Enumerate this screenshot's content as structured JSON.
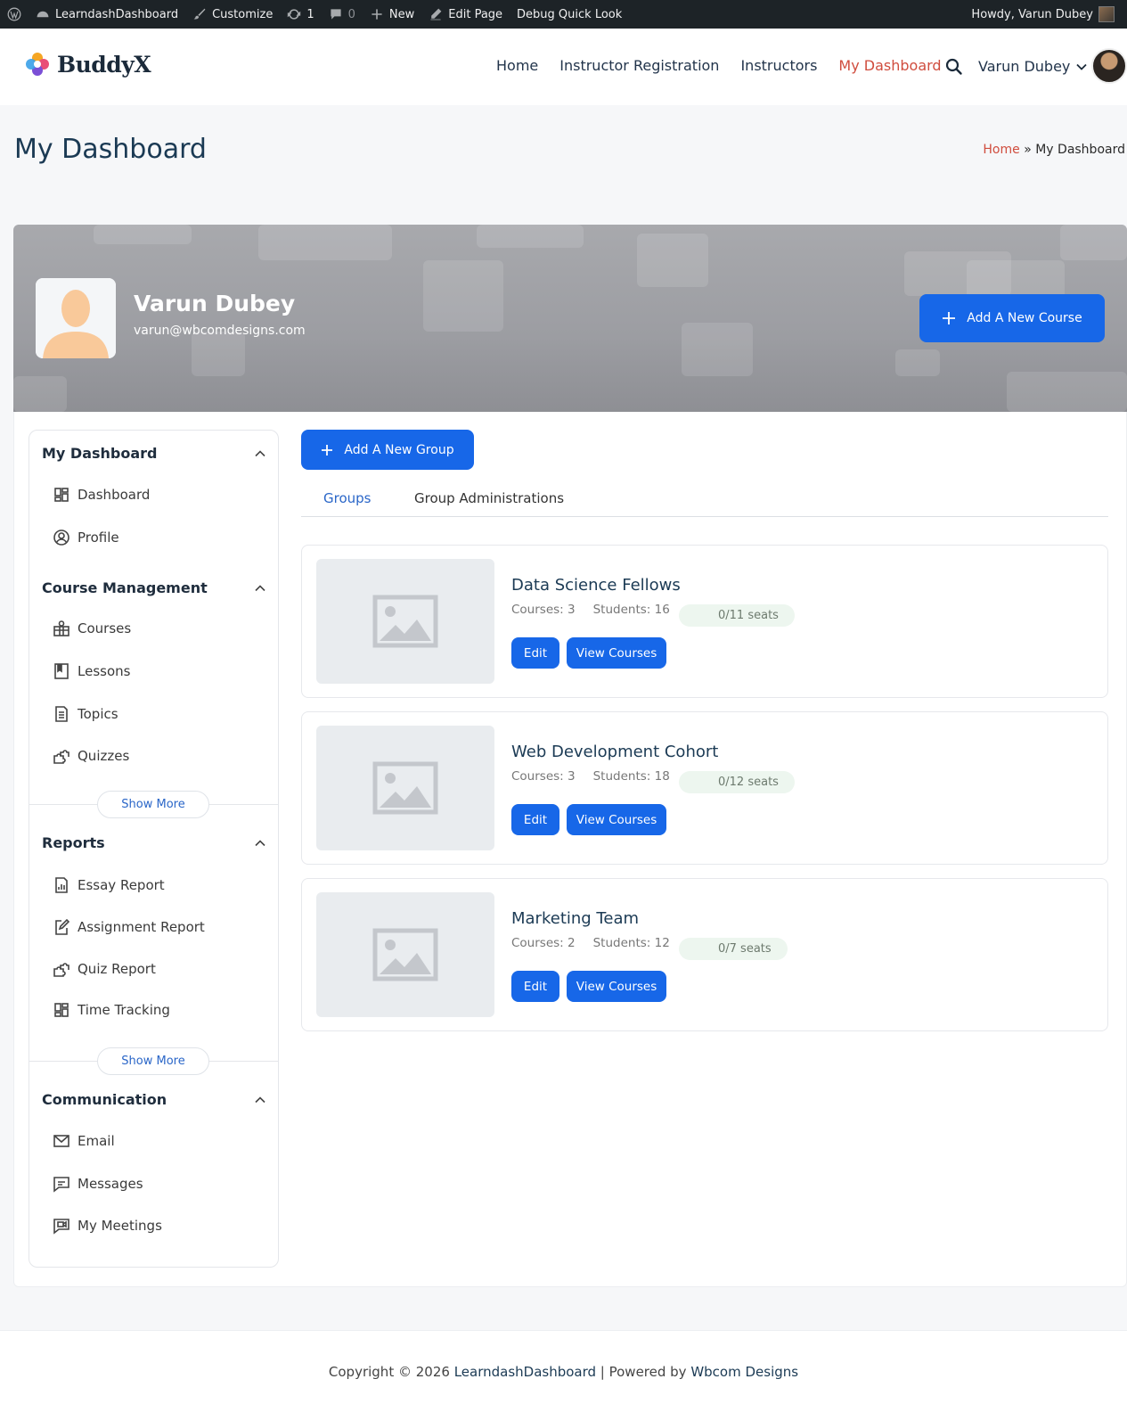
{
  "admin_bar": {
    "site_name": "LearndashDashboard",
    "customize": "Customize",
    "updates_count": "1",
    "comments_count": "0",
    "new_label": "New",
    "edit_page": "Edit Page",
    "debug": "Debug Quick Look",
    "howdy": "Howdy, Varun Dubey"
  },
  "header": {
    "logo_text": "BuddyX",
    "nav": [
      {
        "label": "Home",
        "active": false
      },
      {
        "label": "Instructor Registration",
        "active": false
      },
      {
        "label": "Instructors",
        "active": false
      },
      {
        "label": "My Dashboard",
        "active": true
      }
    ],
    "user_name": "Varun Dubey"
  },
  "page": {
    "title": "My Dashboard",
    "breadcrumb_home": "Home",
    "breadcrumb_sep": "»",
    "breadcrumb_current": "My Dashboard"
  },
  "profile": {
    "name": "Varun Dubey",
    "email": "varun@wbcomdesigns.com",
    "add_course_label": "Add A New Course"
  },
  "sidebar": {
    "sections": [
      {
        "title": "My Dashboard",
        "items": [
          "Dashboard",
          "Profile"
        ]
      },
      {
        "title": "Course Management",
        "items": [
          "Courses",
          "Lessons",
          "Topics",
          "Quizzes"
        ],
        "show_more": "Show More"
      },
      {
        "title": "Reports",
        "items": [
          "Essay Report",
          "Assignment Report",
          "Quiz Report",
          "Time Tracking"
        ],
        "show_more": "Show More"
      },
      {
        "title": "Communication",
        "items": [
          "Email",
          "Messages",
          "My Meetings"
        ]
      }
    ]
  },
  "content": {
    "add_group_label": "Add A New Group",
    "tabs": [
      {
        "label": "Groups",
        "active": true
      },
      {
        "label": "Group Administrations",
        "active": false
      }
    ],
    "groups": [
      {
        "title": "Data Science Fellows",
        "courses": "Courses: 3",
        "students": "Students: 16",
        "seats": "0/11 seats",
        "edit": "Edit",
        "view": "View Courses"
      },
      {
        "title": "Web Development Cohort",
        "courses": "Courses: 3",
        "students": "Students: 18",
        "seats": "0/12 seats",
        "edit": "Edit",
        "view": "View Courses"
      },
      {
        "title": "Marketing Team",
        "courses": "Courses: 2",
        "students": "Students: 12",
        "seats": "0/7 seats",
        "edit": "Edit",
        "view": "View Courses"
      }
    ]
  },
  "footer": {
    "prefix": "Copyright © 2026 ",
    "site": "LearndashDashboard",
    "mid": " | Powered by ",
    "powered": "Wbcom Designs"
  },
  "colors": {
    "accent": "#1767e8",
    "nav_active": "#d04d3e",
    "seat_badge_bg": "#edf6ef"
  },
  "icons": {
    "sidebar": [
      "dashboard-grid-icon",
      "profile-icon",
      "courses-icon",
      "lessons-icon",
      "topics-icon",
      "quizzes-icon",
      "essay-report-icon",
      "assignment-report-icon",
      "quiz-report-icon",
      "time-tracking-icon",
      "email-icon",
      "messages-icon",
      "meetings-icon"
    ]
  }
}
